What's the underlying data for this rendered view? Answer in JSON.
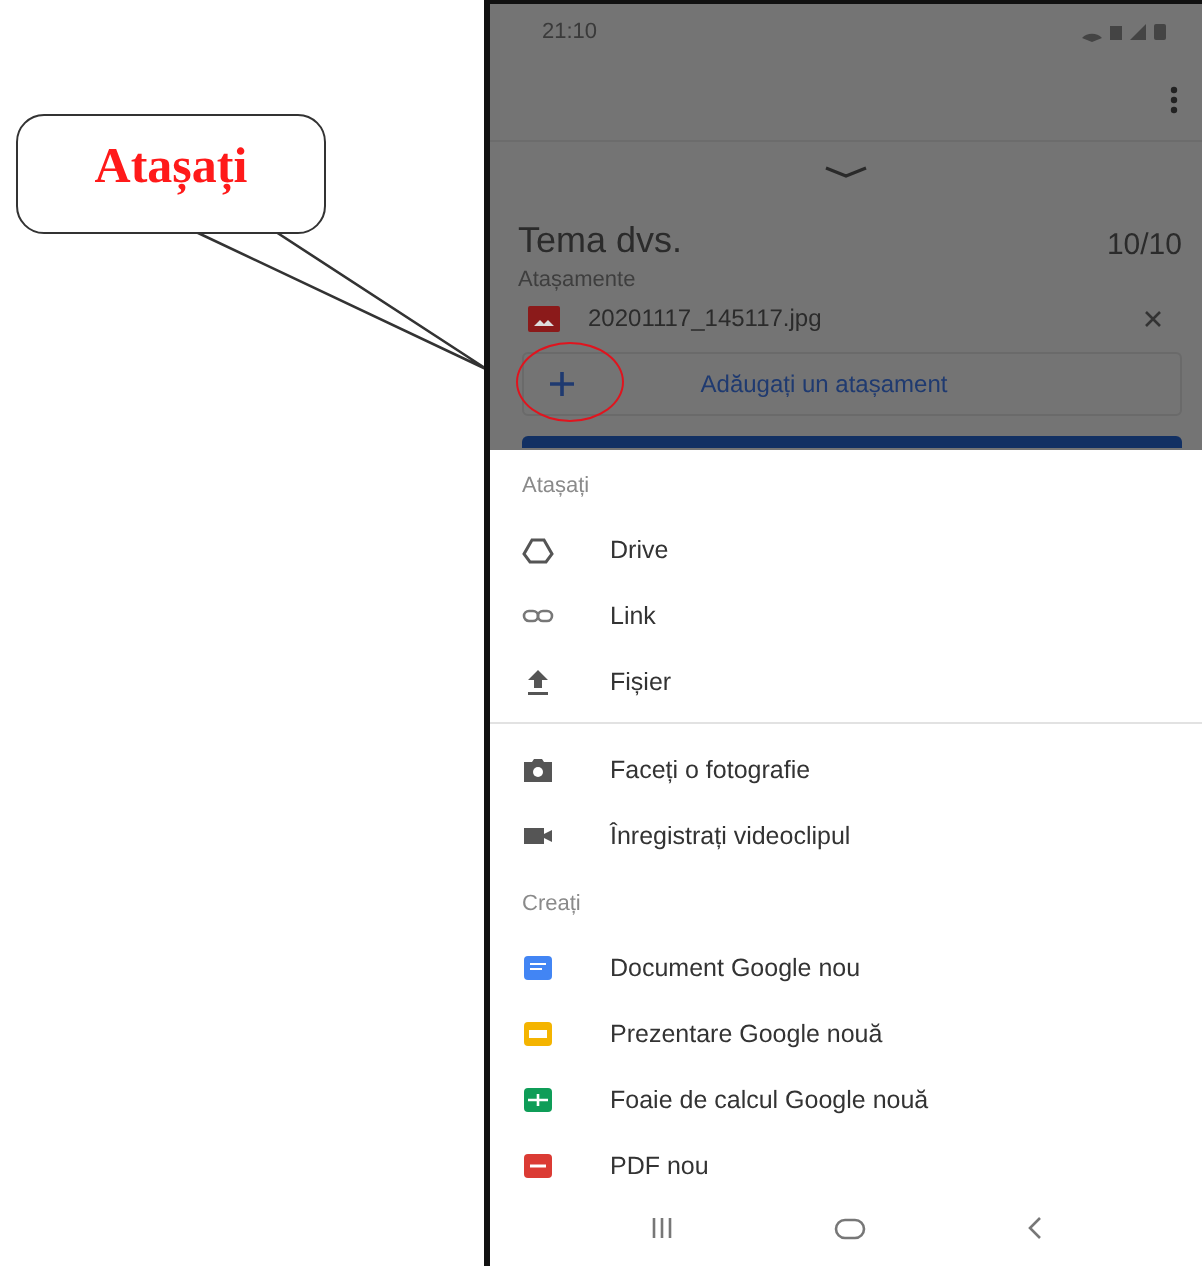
{
  "annotation": {
    "label": "Atașați"
  },
  "status_bar": {
    "time": "21:10"
  },
  "assignment": {
    "title": "Tema dvs.",
    "grade": "10/10",
    "attachments_label": "Atașamente",
    "attachments": [
      {
        "name": "20201117_145117.jpg"
      }
    ],
    "add_button": {
      "label": "Adăugați un atașament"
    }
  },
  "sheet": {
    "groups": [
      {
        "header": "Atașați",
        "divider_above": false,
        "items": [
          {
            "kind": "drive",
            "label": "Drive"
          },
          {
            "kind": "link",
            "label": "Link"
          },
          {
            "kind": "upload",
            "label": "Fișier"
          }
        ]
      },
      {
        "divider_above": true,
        "items": [
          {
            "kind": "camera",
            "label": "Faceți o fotografie"
          },
          {
            "kind": "video",
            "label": "Înregistrați videoclipul"
          }
        ]
      },
      {
        "header": "Creați",
        "divider_above": false,
        "items": [
          {
            "kind": "doc",
            "label": "Document Google nou"
          },
          {
            "kind": "slides",
            "label": "Prezentare Google nouă"
          },
          {
            "kind": "sheet",
            "label": "Foaie de calcul Google nouă"
          },
          {
            "kind": "pdf",
            "label": "PDF nou"
          }
        ]
      }
    ]
  }
}
